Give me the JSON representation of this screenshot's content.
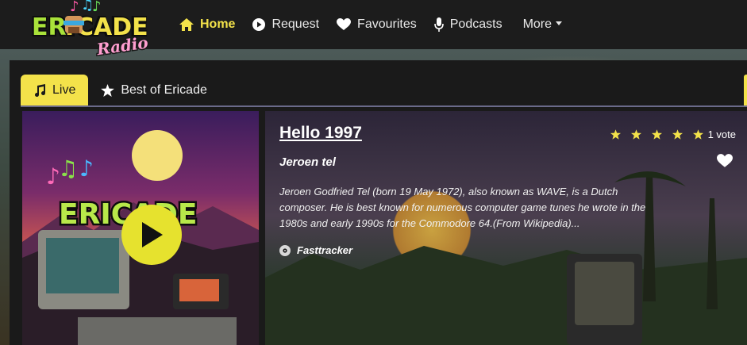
{
  "brand": {
    "logo_main": "ERICADE",
    "logo_sub": "Radio"
  },
  "nav": {
    "items": [
      {
        "label": "Home",
        "icon": "home-icon",
        "active": true
      },
      {
        "label": "Request",
        "icon": "play-circle-icon"
      },
      {
        "label": "Favourites",
        "icon": "heart-icon"
      },
      {
        "label": "Podcasts",
        "icon": "microphone-icon"
      },
      {
        "label": "More",
        "icon": "chevron-down-icon"
      }
    ]
  },
  "tabs": [
    {
      "label": "Live",
      "icon": "music-note-icon",
      "active": true
    },
    {
      "label": "Best of Ericade",
      "icon": "star-icon"
    }
  ],
  "cover": {
    "text": "ERICADE"
  },
  "track": {
    "title": "Hello 1997",
    "artist": "Jeroen tel",
    "description": "Jeroen Godfried Tel (born 19 May 1972), also known as WAVE, is a Dutch composer. He is best known for numerous computer game tunes he wrote in the 1980s and early 1990s for the Commodore 64.(From Wikipedia)...",
    "tracker": "Fasttracker",
    "rating": {
      "stars": 5,
      "votes_label": "1 vote"
    }
  },
  "colors": {
    "accent": "#f3e24a",
    "nav_bg": "#1c1c1c",
    "card_bg": "#1a1a1a"
  }
}
